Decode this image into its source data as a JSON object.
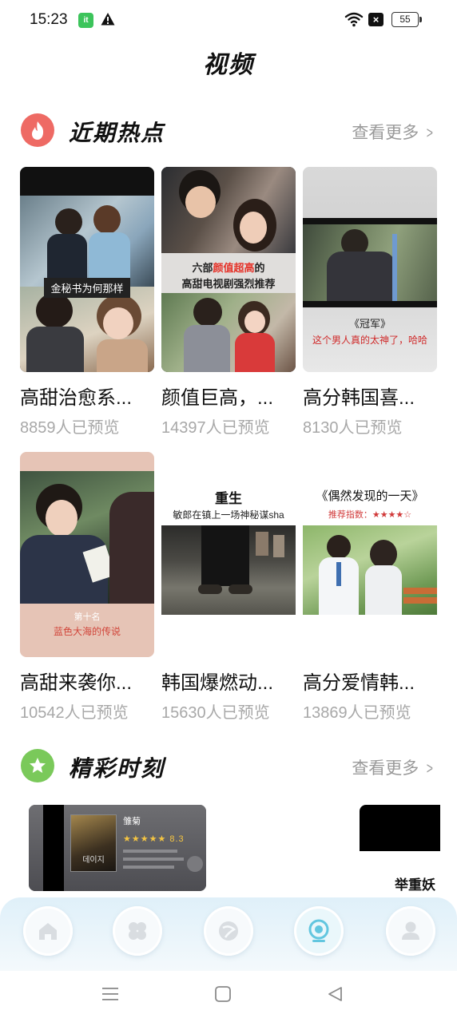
{
  "status_bar": {
    "time": "15:23",
    "battery": "55",
    "app_icon_text": "it"
  },
  "page": {
    "title": "视频"
  },
  "hot_section": {
    "title": "近期热点",
    "more": "查看更多",
    "items": [
      {
        "title": "高甜治愈系...",
        "views": "8859人已预览",
        "caption": "金秘书为何那样"
      },
      {
        "title": "颜值巨高，...",
        "views": "14397人已预览",
        "caption_line1a": "六部",
        "caption_line1b": "颜值超高",
        "caption_line1c": "的",
        "caption_line2": "高甜电视剧强烈推荐"
      },
      {
        "title": "高分韩国喜...",
        "views": "8130人已预览",
        "caption_line1": "《冠军》",
        "caption_line2": "这个男人真的太神了，哈哈"
      },
      {
        "title": "高甜来袭你...",
        "views": "10542人已预览",
        "caption_line1": "第十名",
        "caption_line2": "蓝色大海的传说"
      },
      {
        "title": "韩国爆燃动...",
        "views": "15630人已预览",
        "caption_line1": "重生",
        "caption_line2": "敏郎在镇上一场神秘谋sha"
      },
      {
        "title": "高分爱情韩...",
        "views": "13869人已预览",
        "caption_line1": "《偶然发现的一天》",
        "caption_line2": "推荐指数：★★★★☆"
      }
    ]
  },
  "highlight_section": {
    "title": "精彩时刻",
    "more": "查看更多",
    "card1": {
      "name": "雏菊",
      "rating": "8.3",
      "poster_text": "데이지"
    },
    "card2": {
      "caption": "举重妖"
    }
  },
  "colors": {
    "hot_icon": "#ee6a64",
    "highlight_icon": "#7ac95a",
    "accent_nav": "#62c6df",
    "more_text": "#9a9a9a"
  },
  "nav": [
    "home-icon",
    "apps-icon",
    "discover-icon",
    "video-icon",
    "profile-icon"
  ]
}
